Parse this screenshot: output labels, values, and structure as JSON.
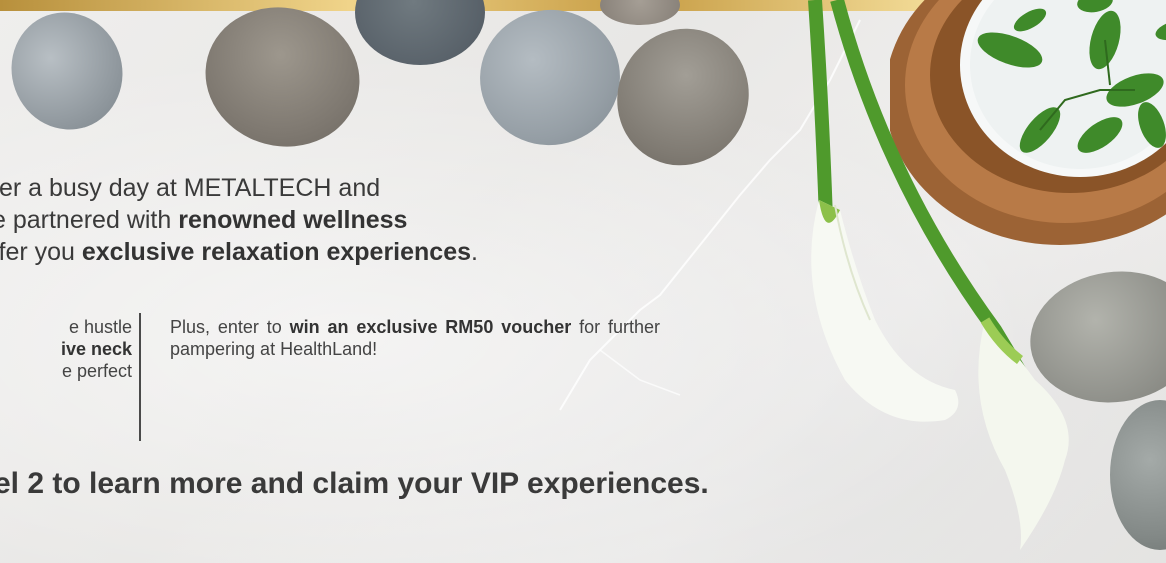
{
  "intro": {
    "line1": "ter a busy day at METALTECH and",
    "line2_pre": "e partnered with ",
    "line2_bold": "renowned wellness",
    "line3_pre": "ffer you ",
    "line3_bold": "exclusive relaxation experiences",
    "line3_post": "."
  },
  "left_column": {
    "line1": "e hustle",
    "line2_bold": "ive neck",
    "line3": "e perfect"
  },
  "right_column": {
    "pre": "Plus, enter to ",
    "bold1": "win an exclusive RM50",
    "bold2": "voucher",
    "post": " for further pampering at HealthLand!"
  },
  "cta": {
    "text": "el 2 to learn more and claim your VIP experiences."
  },
  "colors": {
    "gold_accent": "#d4ae5c",
    "stone_grey": "#9aa0a3",
    "wood_bowl": "#a46a3c",
    "leaf_green": "#3f8a2a"
  }
}
